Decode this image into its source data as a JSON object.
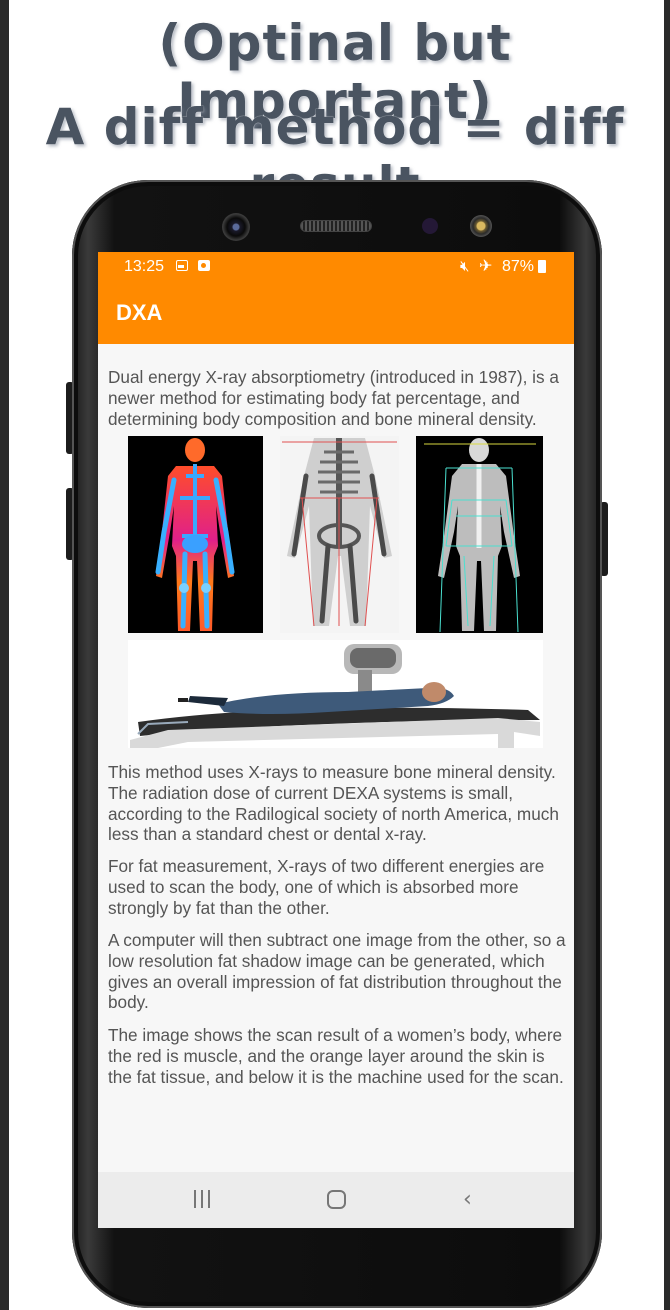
{
  "headline": {
    "line1": "(Optinal but Important)",
    "line2": "A diff method = diff result"
  },
  "status_bar": {
    "time": "13:25",
    "battery": "87%",
    "icons": [
      "gallery-icon",
      "screen-recorder-icon",
      "mute-icon",
      "airplane-mode-icon",
      "battery-icon"
    ]
  },
  "app_bar": {
    "title": "DXA"
  },
  "content": {
    "intro": "Dual energy X-ray absorptiometry (introduced in 1987), is a newer method for estimating body fat percentage, and determining body composition and bone mineral density.",
    "paragraphs": [
      "This method uses X-rays to measure bone mineral density. The radiation dose of current DEXA systems is small, according to the Radilogical society of north America, much less than a standard chest or dental x-ray.",
      "For fat measurement, X-rays of two different energies are used to scan the body, one of which is absorbed more strongly by fat than the other.",
      "A computer will then subtract one image from the other, so a low resolution fat shadow image can be generated, which gives an overall impression of fat distribution throughout the body.",
      "The image shows the scan result of a women’s body, where the red is muscle, and the orange layer around the skin is the fat tissue, and below it is the machine used for the scan."
    ]
  },
  "nav_bar": {
    "buttons": [
      "recent-apps",
      "home",
      "back"
    ],
    "back_glyph": "‹"
  },
  "colors": {
    "accent": "#ff8a00",
    "text": "#555555",
    "background": "#f7f7f7",
    "headline": "#4a5461"
  }
}
